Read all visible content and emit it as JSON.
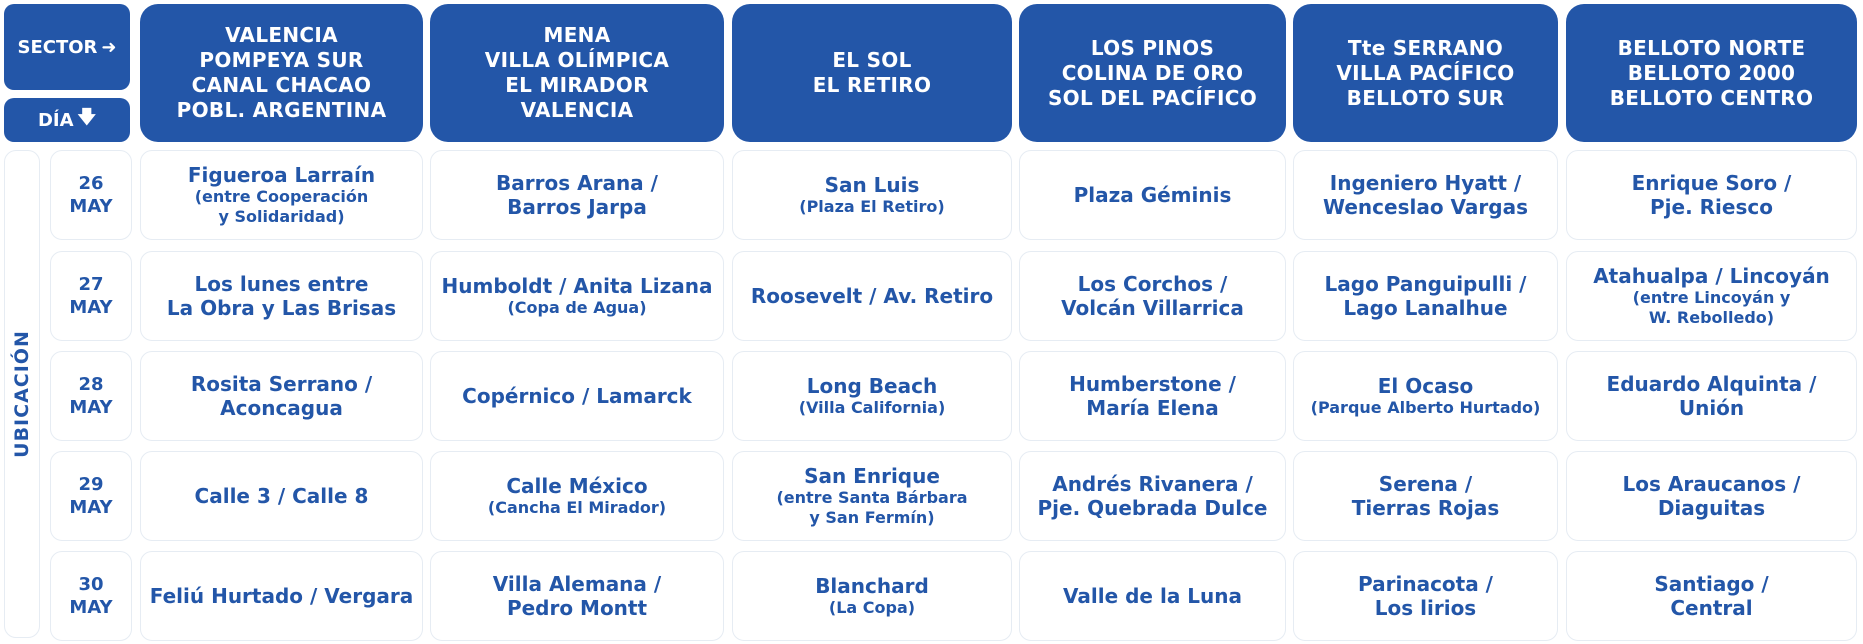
{
  "labels": {
    "sector": "SECTOR",
    "dia": "DÍA",
    "ubicacion": "UBICACIÓN"
  },
  "icons": {
    "sector_arrow": "arrow-right-icon",
    "dia_arrow": "arrow-down-icon"
  },
  "colors": {
    "primary": "#2356a8",
    "cell_border": "#e6ecf3",
    "background": "#ffffff"
  },
  "sectors": [
    "VALENCIA\nPOMPEYA SUR\nCANAL CHACAO\nPOBL. ARGENTINA",
    "MENA\nVILLA OLÍMPICA\nEL MIRADOR\nVALENCIA",
    "EL SOL\nEL RETIRO",
    "LOS PINOS\nCOLINA DE ORO\nSOL DEL PACÍFICO",
    "Tte SERRANO\nVILLA PACÍFICO\nBELLOTO SUR",
    "BELLOTO NORTE\nBELLOTO 2000\nBELLOTO CENTRO"
  ],
  "days": [
    {
      "day": "26",
      "month": "MAY",
      "cells": [
        {
          "main": "Figueroa Larraín",
          "sub": "(entre Cooperación\ny Solidaridad)"
        },
        {
          "main": "Barros Arana /\nBarros Jarpa",
          "sub": ""
        },
        {
          "main": "San Luis",
          "sub": "(Plaza El Retiro)"
        },
        {
          "main": "Plaza Géminis",
          "sub": ""
        },
        {
          "main": "Ingeniero Hyatt /\nWenceslao Vargas",
          "sub": ""
        },
        {
          "main": "Enrique Soro /\nPje. Riesco",
          "sub": ""
        }
      ]
    },
    {
      "day": "27",
      "month": "MAY",
      "cells": [
        {
          "main": "Los lunes entre\nLa Obra y Las Brisas",
          "sub": ""
        },
        {
          "main": "Humboldt / Anita Lizana",
          "sub": "(Copa de Agua)"
        },
        {
          "main": "Roosevelt / Av. Retiro",
          "sub": ""
        },
        {
          "main": "Los Corchos /\nVolcán Villarrica",
          "sub": ""
        },
        {
          "main": "Lago Panguipulli /\nLago Lanalhue",
          "sub": ""
        },
        {
          "main": "Atahualpa / Lincoyán",
          "sub": "(entre Lincoyán y\nW. Rebolledo)"
        }
      ]
    },
    {
      "day": "28",
      "month": "MAY",
      "cells": [
        {
          "main": "Rosita Serrano /\nAconcagua",
          "sub": ""
        },
        {
          "main": "Copérnico / Lamarck",
          "sub": ""
        },
        {
          "main": "Long Beach",
          "sub": "(Villa California)"
        },
        {
          "main": "Humberstone /\nMaría Elena",
          "sub": ""
        },
        {
          "main": "El Ocaso",
          "sub": "(Parque Alberto Hurtado)"
        },
        {
          "main": "Eduardo Alquinta /\nUnión",
          "sub": ""
        }
      ]
    },
    {
      "day": "29",
      "month": "MAY",
      "cells": [
        {
          "main": "Calle 3 / Calle 8",
          "sub": ""
        },
        {
          "main": "Calle México",
          "sub": "(Cancha El Mirador)"
        },
        {
          "main": "San Enrique",
          "sub": "(entre Santa Bárbara\ny San Fermín)"
        },
        {
          "main": "Andrés Rivanera /\nPje. Quebrada Dulce",
          "sub": ""
        },
        {
          "main": "Serena /\nTierras Rojas",
          "sub": ""
        },
        {
          "main": "Los Araucanos /\nDiaguitas",
          "sub": ""
        }
      ]
    },
    {
      "day": "30",
      "month": "MAY",
      "cells": [
        {
          "main": "Feliú Hurtado / Vergara",
          "sub": ""
        },
        {
          "main": "Villa Alemana /\nPedro Montt",
          "sub": ""
        },
        {
          "main": "Blanchard",
          "sub": "(La Copa)"
        },
        {
          "main": "Valle de la Luna",
          "sub": ""
        },
        {
          "main": "Parinacota /\nLos lirios",
          "sub": ""
        },
        {
          "main": "Santiago /\nCentral",
          "sub": ""
        }
      ]
    }
  ]
}
